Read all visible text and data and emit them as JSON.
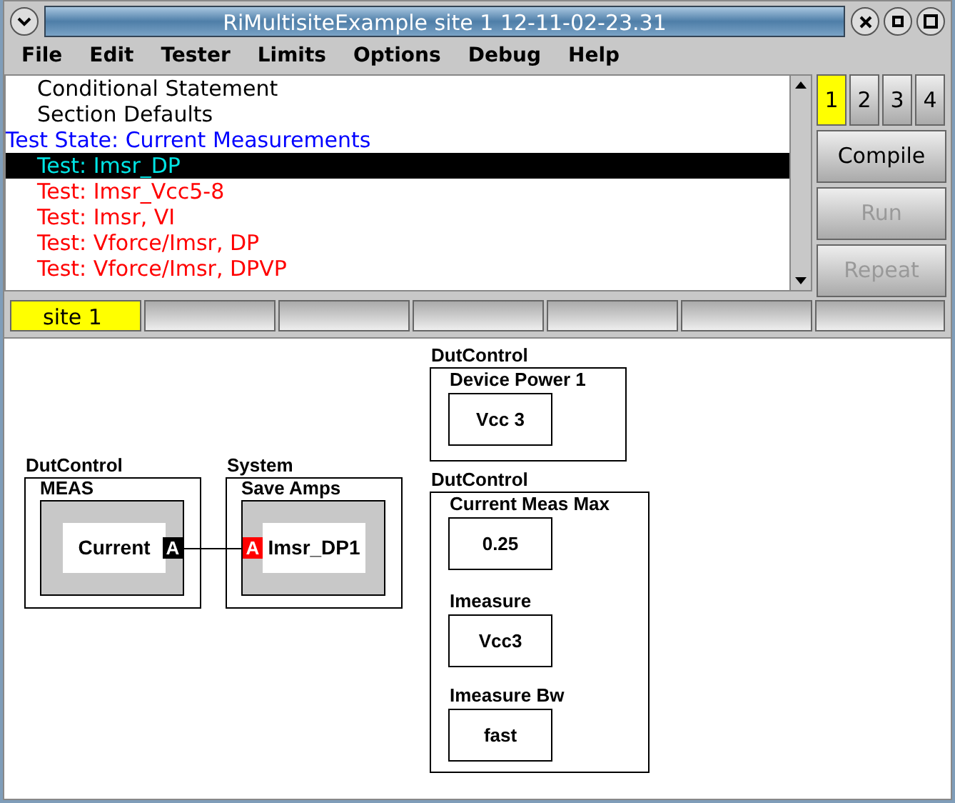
{
  "window": {
    "title": "RiMultisiteExample  site 1 12-11-02-23.31"
  },
  "menu": [
    "File",
    "Edit",
    "Tester",
    "Limits",
    "Options",
    "Debug",
    "Help"
  ],
  "tree": [
    {
      "label": "Conditional Statement",
      "kind": "setting",
      "selected": false
    },
    {
      "label": "Section Defaults",
      "kind": "setting",
      "selected": false
    },
    {
      "label": "Test State: Current Measurements",
      "kind": "state",
      "selected": false,
      "children": [
        {
          "label": "Test: Imsr_DP",
          "kind": "test",
          "selected": true
        },
        {
          "label": "Test: Imsr_Vcc5-8",
          "kind": "test",
          "selected": false
        },
        {
          "label": "Test: Imsr, VI",
          "kind": "test",
          "selected": false
        },
        {
          "label": "Test: Vforce/Imsr, DP",
          "kind": "test",
          "selected": false
        },
        {
          "label": "Test: Vforce/Imsr, DPVP",
          "kind": "test",
          "selected": false
        }
      ]
    }
  ],
  "site_buttons": [
    {
      "label": "1",
      "selected": true
    },
    {
      "label": "2",
      "selected": false
    },
    {
      "label": "3",
      "selected": false
    },
    {
      "label": "4",
      "selected": false
    }
  ],
  "actions": [
    {
      "label": "Compile",
      "disabled": false
    },
    {
      "label": "Run",
      "disabled": true
    },
    {
      "label": "Repeat",
      "disabled": true
    }
  ],
  "site_tabs": [
    {
      "label": "site 1",
      "selected": true
    },
    {
      "selected": false
    },
    {
      "selected": false
    },
    {
      "selected": false
    },
    {
      "selected": false
    },
    {
      "selected": false
    }
  ],
  "canvas": {
    "blocks": [
      {
        "kind": "port_block",
        "category": "DutControl",
        "title": "MEAS",
        "value": "Current",
        "port": {
          "label": "A",
          "kind": "output",
          "color": "#000000"
        }
      },
      {
        "kind": "port_block",
        "category": "System",
        "title": "Save  Amps",
        "value": "Imsr_DP1",
        "port": {
          "label": "A",
          "kind": "input",
          "color": "#ff0000"
        }
      },
      {
        "kind": "param_block",
        "category": "DutControl",
        "params": [
          {
            "label": "Device Power 1",
            "value": "Vcc 3"
          }
        ]
      },
      {
        "kind": "param_block",
        "category": "DutControl",
        "params": [
          {
            "label": "Current Meas Max",
            "value": "0.25"
          },
          {
            "label": "Imeasure",
            "value": "Vcc3"
          },
          {
            "label": "Imeasure Bw",
            "value": "fast"
          }
        ]
      }
    ]
  }
}
